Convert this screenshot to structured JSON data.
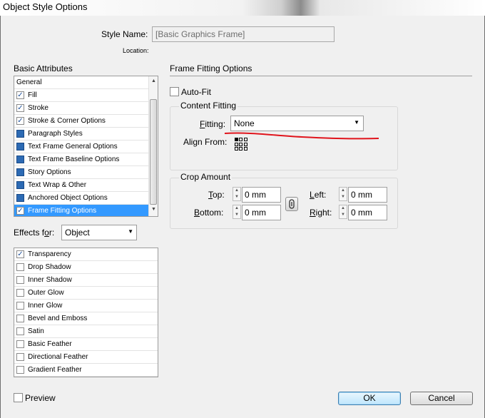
{
  "window": {
    "title": "Object Style Options"
  },
  "style_name": {
    "label": "Style Name:",
    "value": "[Basic Graphics Frame]"
  },
  "location": {
    "label": "Location:"
  },
  "basic_attributes": {
    "heading": "Basic Attributes",
    "items": [
      {
        "label": "General",
        "check": "none"
      },
      {
        "label": "Fill",
        "check": "checked"
      },
      {
        "label": "Stroke",
        "check": "checked"
      },
      {
        "label": "Stroke & Corner Options",
        "check": "checked"
      },
      {
        "label": "Paragraph Styles",
        "check": "blue"
      },
      {
        "label": "Text Frame General Options",
        "check": "blue"
      },
      {
        "label": "Text Frame Baseline Options",
        "check": "blue"
      },
      {
        "label": "Story Options",
        "check": "blue"
      },
      {
        "label": "Text Wrap & Other",
        "check": "blue"
      },
      {
        "label": "Anchored Object Options",
        "check": "blue"
      },
      {
        "label": "Frame Fitting Options",
        "check": "checked",
        "selected": true
      }
    ]
  },
  "effects_for": {
    "label": "Effects for:",
    "value": "Object"
  },
  "effects": {
    "items": [
      {
        "label": "Transparency",
        "checked": true
      },
      {
        "label": "Drop Shadow",
        "checked": false
      },
      {
        "label": "Inner Shadow",
        "checked": false
      },
      {
        "label": "Outer Glow",
        "checked": false
      },
      {
        "label": "Inner Glow",
        "checked": false
      },
      {
        "label": "Bevel and Emboss",
        "checked": false
      },
      {
        "label": "Satin",
        "checked": false
      },
      {
        "label": "Basic Feather",
        "checked": false
      },
      {
        "label": "Directional Feather",
        "checked": false
      },
      {
        "label": "Gradient Feather",
        "checked": false
      }
    ]
  },
  "frame_fitting": {
    "heading": "Frame Fitting Options",
    "auto_fit": {
      "label": "Auto-Fit",
      "checked": false
    },
    "content_fitting": {
      "title": "Content Fitting",
      "fitting_label": "Fitting:",
      "fitting_value": "None",
      "align_from_label": "Align From:"
    },
    "crop_amount": {
      "title": "Crop Amount",
      "top_label": "Top:",
      "top_value": "0 mm",
      "bottom_label": "Bottom:",
      "bottom_value": "0 mm",
      "left_label": "Left:",
      "left_value": "0 mm",
      "right_label": "Right:",
      "right_value": "0 mm"
    }
  },
  "preview": {
    "label": "Preview",
    "checked": false
  },
  "buttons": {
    "ok": "OK",
    "cancel": "Cancel"
  },
  "colors": {
    "selection": "#3399ff",
    "annotation": "#e0141c"
  }
}
